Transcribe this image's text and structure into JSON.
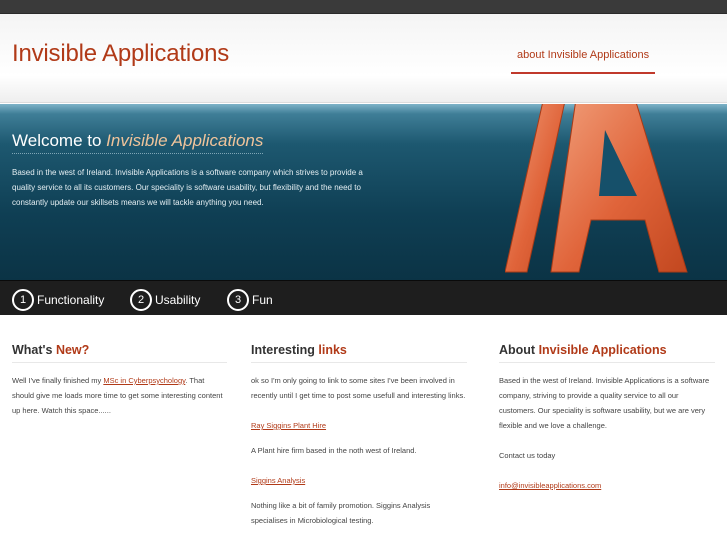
{
  "header": {
    "site_title": "Invisible Applications",
    "nav_about": "about Invisible Applications"
  },
  "hero": {
    "welcome_prefix": "Welcome to ",
    "welcome_name": "Invisible Applications",
    "intro": "Based in the west of Ireland. Invisible Applications is a software company which strives to provide a quality service to all its customers. Our speciality is software usability, but flexibility and the need to constantly update our skillsets means we will tackle anything you need.",
    "logo_letters": "IA"
  },
  "features": [
    {
      "number": "1",
      "label": "Functionality"
    },
    {
      "number": "2",
      "label": "Usability"
    },
    {
      "number": "3",
      "label": "Fun"
    }
  ],
  "whats_new": {
    "heading_plain": "What's ",
    "heading_accent": "New?",
    "text_before": "Well I've finally finished my ",
    "link": "MSc in Cyberpsychology",
    "text_after": ". That should give me loads more time to get some interesting content up here. Watch this space......"
  },
  "links": {
    "heading_plain": "Interesting ",
    "heading_accent": "links",
    "intro": "ok so I'm only going to link to some sites I've been involved in recently until I get time to post some usefull and interesting links.",
    "items": [
      {
        "label": "Ray Siggins Plant Hire",
        "description": "A Plant hire firm based in the noth west of Ireland."
      },
      {
        "label": "Siggins Analysis",
        "description": "Nothing like a bit of family promotion. Siggins Analysis specialises in Microbiological testing."
      }
    ]
  },
  "about": {
    "heading_plain": "About ",
    "heading_accent": "Invisible Applications",
    "text": "Based in the west of Ireland. Invisible Applications is a software company, striving to provide a quality service to all our customers. Our speciality is software usability, but we are very flexible and we love a challenge.",
    "contact": "Contact us today",
    "email": "info@invisibleapplications.com"
  },
  "colors": {
    "accent": "#b13a18",
    "hero_dark": "#0f3f54",
    "bar": "#1e1e1e"
  }
}
